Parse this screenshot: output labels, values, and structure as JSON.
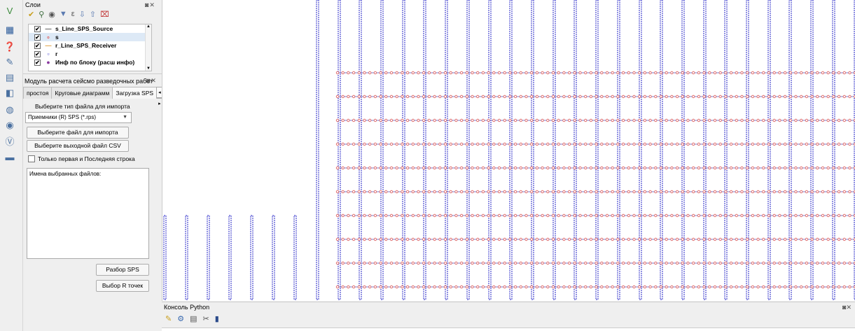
{
  "toolbar_icons": [
    "add-vector-layer-icon",
    "add-raster-layer-icon",
    "add-postgis-layer-icon",
    "new-shapefile-icon",
    "add-wms-layer-icon",
    "add-wfs-layer-icon",
    "add-wcs-layer-icon",
    "add-delimited-text-icon",
    "add-virtual-layer-icon",
    "add-layer-group-icon"
  ],
  "layers_panel": {
    "title": "Слои",
    "controls": "◙✕",
    "items": [
      {
        "symbol": "—",
        "symbol_color": "#555555",
        "label": "s_Line_SPS_Source",
        "checked": true,
        "selected": false
      },
      {
        "symbol": "∘",
        "symbol_color": "#e07070",
        "label": "s",
        "checked": true,
        "selected": true
      },
      {
        "symbol": "—",
        "symbol_color": "#e0a040",
        "label": "r_Line_SPS_Receiver",
        "checked": true,
        "selected": false
      },
      {
        "symbol": "▫",
        "symbol_color": "#4a4ad0",
        "label": "r",
        "checked": true,
        "selected": false
      },
      {
        "symbol": "●",
        "symbol_color": "#8a3aa0",
        "label": "Инф по блоку (расш инфо)",
        "checked": true,
        "selected": false
      }
    ],
    "scroll_up": "▲",
    "scroll_down": "▼"
  },
  "module_panel": {
    "title": "Модуль расчета сейсмо разведочных работ",
    "controls": "◙✕",
    "tabs": [
      "простоя",
      "Круговые диаграмм",
      "Загрузка SPS"
    ],
    "active_tab": "Загрузка SPS",
    "tab_arrows": "◂ ▸",
    "import_type_label": "Выберите тип файла для импорта",
    "import_type_value": "Приемники (R) SPS (*.rps)",
    "combo_arrow": "▼",
    "choose_import_button": "Выберите файл для импорта",
    "choose_output_button": "Выберите выходной файл CSV",
    "first_last_checkbox": "Только первая и Последняя строка",
    "selected_files_label": "Имена выбранных файлов:",
    "parse_sps_button": "Разбор SPS",
    "select_r_points_button": "Выбор R точек"
  },
  "map": {
    "receiver_color": "#4a4ad0",
    "source_color": "#e07070",
    "source_line_color": "#7a7ac8"
  },
  "console": {
    "title": "Консоль Python",
    "controls": "◙✕",
    "tools": [
      "clear-console-icon",
      "run-command-icon",
      "show-editor-icon",
      "settings-icon",
      "help-icon"
    ]
  }
}
